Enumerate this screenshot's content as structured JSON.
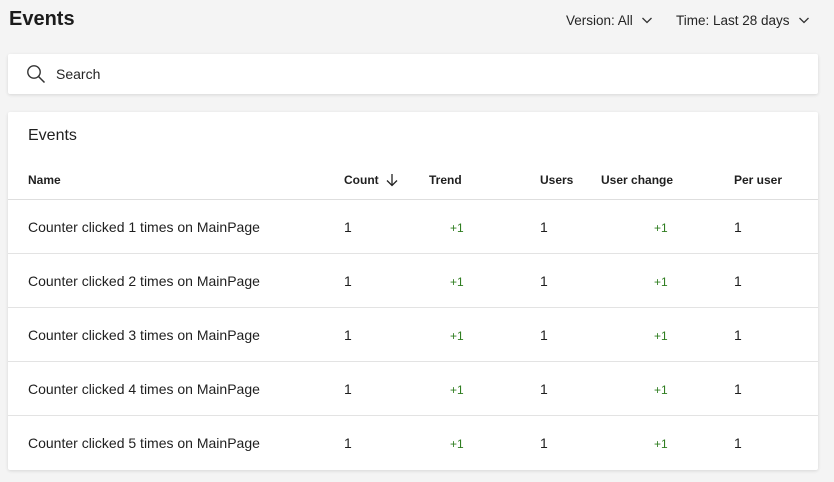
{
  "header": {
    "title": "Events",
    "version_filter": "Version: All",
    "time_filter": "Time: Last 28 days"
  },
  "search": {
    "placeholder": "Search",
    "value": ""
  },
  "events_card": {
    "title": "Events",
    "columns": {
      "name": "Name",
      "count": "Count",
      "trend": "Trend",
      "users": "Users",
      "user_change": "User change",
      "per_user": "Per user"
    },
    "sort": {
      "column": "count",
      "direction": "descending"
    },
    "rows": [
      {
        "name": "Counter clicked 1 times on MainPage",
        "count": "1",
        "trend": "+1",
        "users": "1",
        "user_change": "+1",
        "per_user": "1"
      },
      {
        "name": "Counter clicked 2 times on MainPage",
        "count": "1",
        "trend": "+1",
        "users": "1",
        "user_change": "+1",
        "per_user": "1"
      },
      {
        "name": "Counter clicked 3 times on MainPage",
        "count": "1",
        "trend": "+1",
        "users": "1",
        "user_change": "+1",
        "per_user": "1"
      },
      {
        "name": "Counter clicked 4 times on MainPage",
        "count": "1",
        "trend": "+1",
        "users": "1",
        "user_change": "+1",
        "per_user": "1"
      },
      {
        "name": "Counter clicked 5 times on MainPage",
        "count": "1",
        "trend": "+1",
        "users": "1",
        "user_change": "+1",
        "per_user": "1"
      }
    ]
  },
  "colors": {
    "background": "#f4f4f4",
    "card": "#ffffff",
    "positive_change": "#2e7d1f",
    "text": "#1f1f1f"
  },
  "icons": {
    "search": "search-icon",
    "dropdown": "chevron-down-icon",
    "sort": "arrow-down-icon"
  }
}
